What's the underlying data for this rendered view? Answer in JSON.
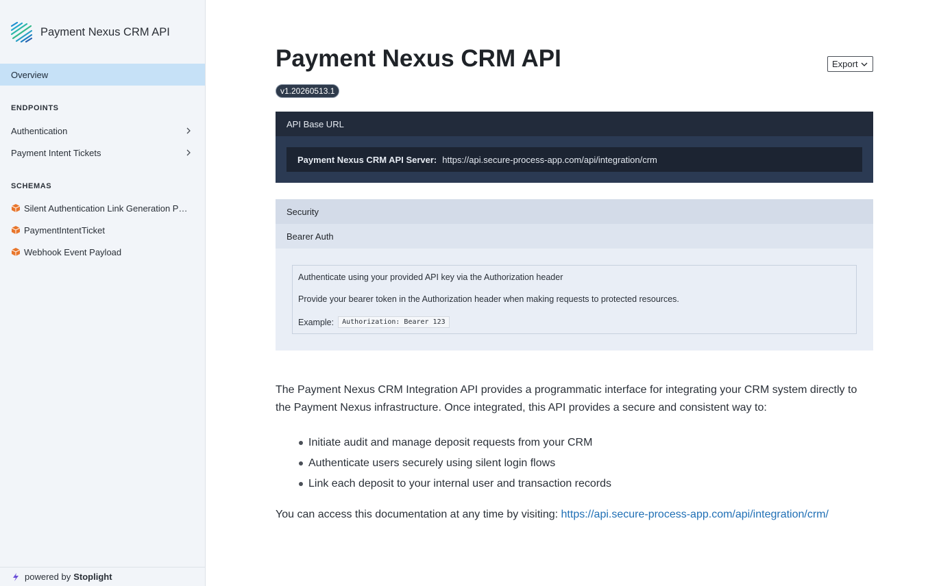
{
  "sidebar": {
    "brand_title": "Payment Nexus CRM API",
    "overview_label": "Overview",
    "endpoints_heading": "ENDPOINTS",
    "endpoints": [
      {
        "label": "Authentication"
      },
      {
        "label": "Payment Intent Tickets"
      }
    ],
    "schemas_heading": "SCHEMAS",
    "schemas": [
      {
        "label": "Silent Authentication Link Generation Pa..."
      },
      {
        "label": "PaymentIntentTicket"
      },
      {
        "label": "Webhook Event Payload"
      }
    ],
    "powered_prefix": "powered by",
    "powered_brand": "Stoplight"
  },
  "main": {
    "title": "Payment Nexus CRM API",
    "version": "v1.20260513.1",
    "export_label": "Export",
    "base_url": {
      "heading": "API Base URL",
      "server_label": "Payment Nexus CRM API Server:",
      "server_url": "https://api.secure-process-app.com/api/integration/crm"
    },
    "security": {
      "heading": "Security",
      "scheme": "Bearer Auth",
      "description": "Authenticate using your provided API key via the Authorization header",
      "detail": "Provide your bearer token in the Authorization header when making requests to protected resources.",
      "example_label": "Example:",
      "example_code": "Authorization: Bearer 123"
    },
    "description": "The Payment Nexus CRM Integration API provides a programmatic interface for integrating your CRM system directly to the Payment Nexus infrastructure. Once integrated, this API provides a secure and consistent way to:",
    "bullets": [
      "Initiate audit and manage deposit requests from your CRM",
      "Authenticate users securely using silent login flows",
      "Link each deposit to your internal user and transaction records"
    ],
    "access_text": "You can access this documentation at any time by visiting: ",
    "access_link": "https://api.secure-process-app.com/api/integration/crm/"
  },
  "colors": {
    "accent": "#1f6fb5",
    "selected_nav": "#c6e1f7",
    "dark_panel": "#2b3a53",
    "schema_icon": "#e8762c"
  },
  "icons": {
    "brand": "stoplight-stripes-logo",
    "chevron": "chevron-right-icon",
    "schema": "cube-icon",
    "powered": "bolt-icon",
    "export": "chevron-down-icon"
  }
}
